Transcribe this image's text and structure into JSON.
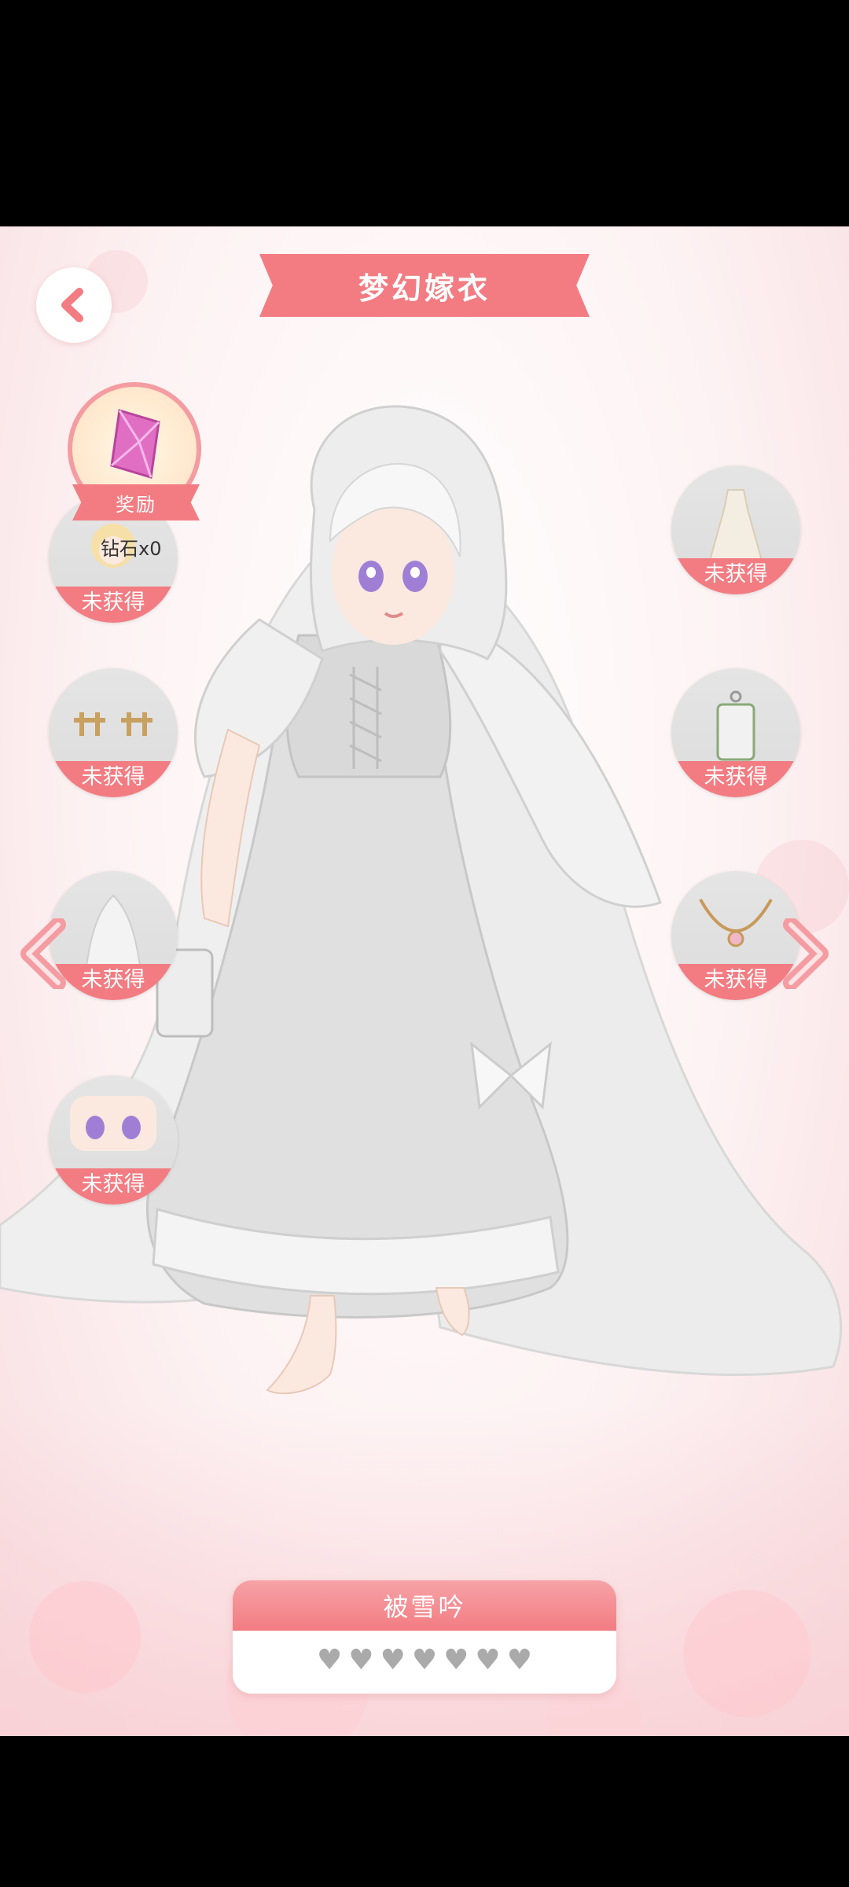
{
  "header": {
    "title": "梦幻嫁衣",
    "back_icon": "chevron-left-icon"
  },
  "reward": {
    "tag": "奖励",
    "text": "钻石x0",
    "icon": "diamond-icon"
  },
  "slots": {
    "left": [
      {
        "status": "未获得",
        "icon": "hair-icon"
      },
      {
        "status": "未获得",
        "icon": "hair-accessory-icon"
      },
      {
        "status": "未获得",
        "icon": "veil-icon"
      },
      {
        "status": "未获得",
        "icon": "eyes-icon"
      }
    ],
    "right": [
      {
        "status": "未获得",
        "icon": "dress-icon"
      },
      {
        "status": "未获得",
        "icon": "lantern-icon"
      },
      {
        "status": "未获得",
        "icon": "necklace-icon"
      }
    ]
  },
  "suit": {
    "name": "被雪吟",
    "hearts_total": 7,
    "hearts_filled": 0
  },
  "colors": {
    "accent": "#f27c82",
    "slot_bg": "#e2e2e2"
  }
}
